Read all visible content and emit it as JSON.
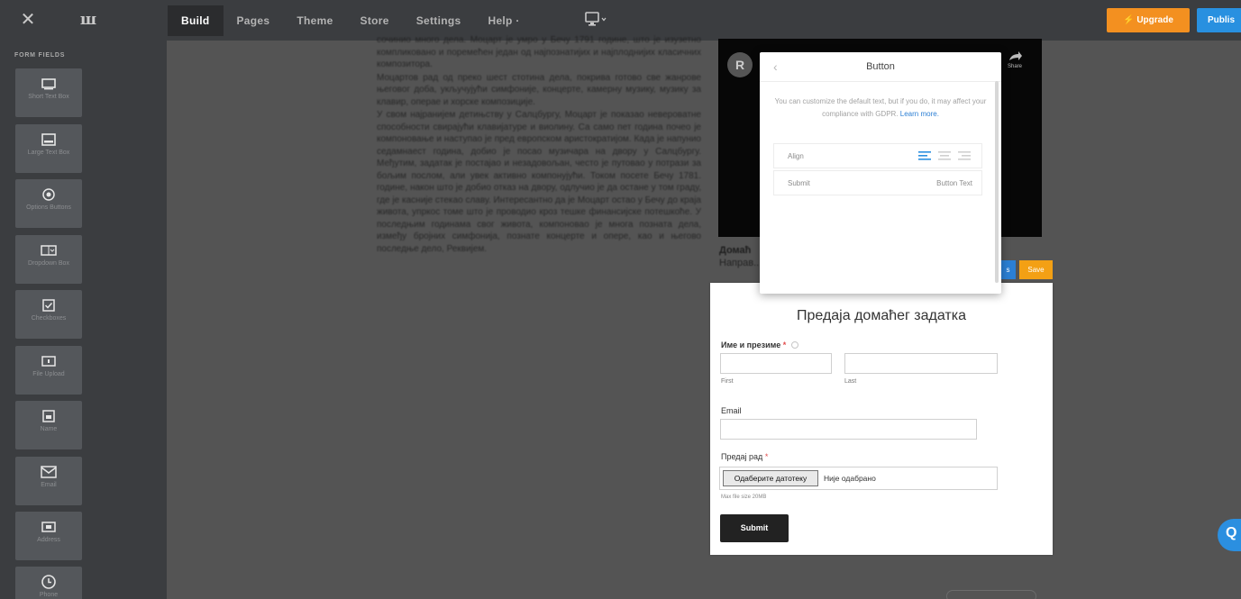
{
  "topbar": {
    "close_icon": "close-icon",
    "logo_icon": "weebly-logo",
    "nav": [
      "Build",
      "Pages",
      "Theme",
      "Store",
      "Settings",
      "Help ·"
    ],
    "device_icon": "monitor-icon",
    "upgrade_label": "Upgrade",
    "publish_label": "Publis"
  },
  "left_panel": {
    "heading": "FORM FIELDS",
    "tiles": [
      {
        "icon": "short-text-icon",
        "label": "Short Text Box"
      },
      {
        "icon": "large-text-icon",
        "label": "Large Text Box"
      },
      {
        "icon": "radio-icon",
        "label": "Options Buttons"
      },
      {
        "icon": "dropdown-icon",
        "label": "Dropdown Box"
      },
      {
        "icon": "checkbox-icon",
        "label": "Checkboxes"
      },
      {
        "icon": "upload-icon",
        "label": "File Upload"
      },
      {
        "icon": "name-icon",
        "label": "Name"
      },
      {
        "icon": "email-icon",
        "label": "Email"
      },
      {
        "icon": "address-icon",
        "label": "Address"
      },
      {
        "icon": "clock-icon",
        "label": "Phone"
      }
    ]
  },
  "document": {
    "paragraphs": [
      "сочинио много дела. Моцарт је умро у Бечу 1791 године, што је изузетно компликовано и поремећен један од најпознатијих и најплоднијих класичних композитора.",
      "Моцартов рад од преко шест стотина дела, покрива готово све жанрове његовог доба, укључујући симфоније, концерте, камерну музику, музику за клавир, операе и хорске композиције.",
      "У свом најранијем детињству у Салцбургу, Моцарт је показао невероватне способности свирајући клавијатуре и виолину. Са само пет година почео је компоновање и наступао је пред европском аристократијом. Када је напунио седамнаест година, добио је посао музичара на двору у Салцбургу. Међутим, задатак је постајао и незадовољан, често је путовао у потрази за бољим послом, али увек активно компонујући. Током посете Бечу 1781. године, након што је добио отказ на двору, одлучио је да остане у том граду, где је касније стекао славу. Интересантно да је Моцарт остао у Бечу до краја живота, упркос томе што је проводио кроз тешке финансијске потешкоће. У последњим годинама свог живота, компоновао је многа позната дела, између бројних симфонија, познате концерте и опере, као и његово последње дело, Реквијем."
    ]
  },
  "video": {
    "avatar_letter": "R",
    "share_label": "Share"
  },
  "section": {
    "title": "Домаћ",
    "subtitle": "Направ..."
  },
  "mini_buttons": {
    "blue_label": "s",
    "orange_label": "Save"
  },
  "form": {
    "title": "Предаја домаћег задатка",
    "name_label": "Име и презиме",
    "required_mark": "*",
    "first_sub": "First",
    "last_sub": "Last",
    "email_label": "Email",
    "upload_label": "Предај рад",
    "choose_file": "Одаберите датотеку",
    "no_file": "Није одабрано",
    "max_size": "Max file size 20MB",
    "submit_label": "Submit"
  },
  "popover": {
    "title": "Button",
    "note": "You can customize the default text, but if you do, it may affect your compliance with GDPR.",
    "note_link": "Learn more.",
    "rows": [
      {
        "key": "Align",
        "value": ""
      },
      {
        "key": "Submit",
        "value": "Button Text"
      }
    ]
  },
  "colors": {
    "topbar": "#3b3d40",
    "canvas": "#545454",
    "upgrade": "#f39020",
    "publish": "#2890e0",
    "accent_blue": "#2b7fd4"
  }
}
